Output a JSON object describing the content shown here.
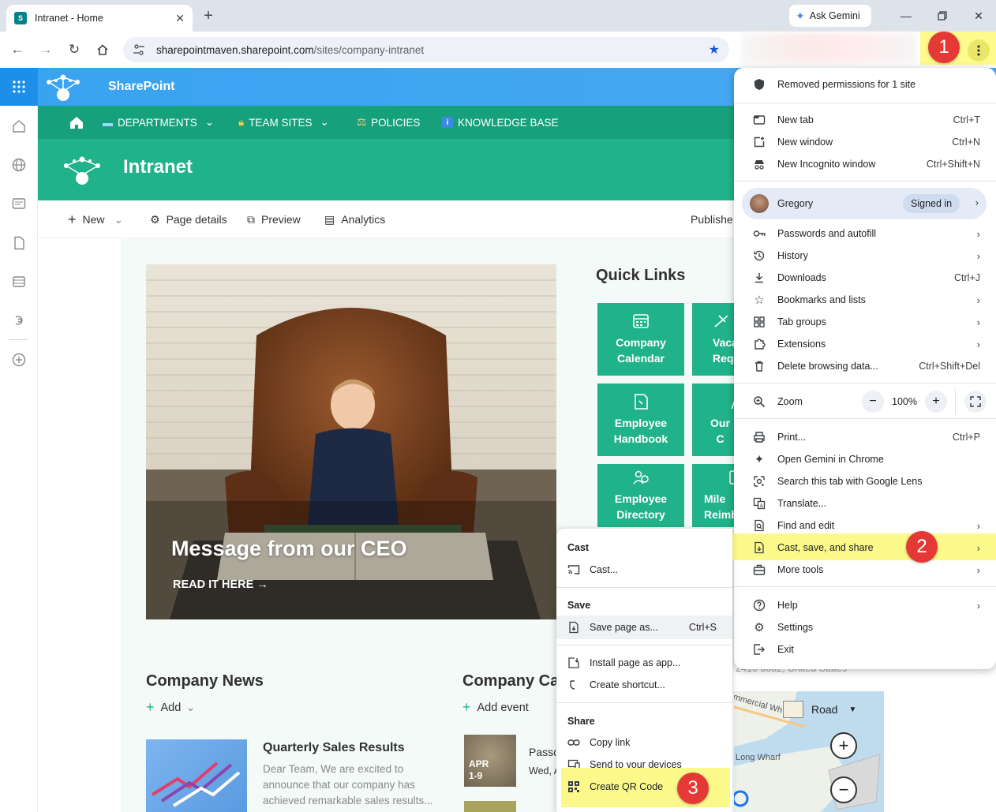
{
  "browser": {
    "tab_title": "Intranet - Home",
    "new_tab_symbol": "+",
    "ask_gemini": "Ask Gemini",
    "url_host": "sharepointmaven.sharepoint.com",
    "url_path": "/sites/company-intranet"
  },
  "sharepoint": {
    "suite_title": "SharePoint",
    "hub_nav": [
      {
        "label": "DEPARTMENTS",
        "icon": "laptop-icon",
        "dropdown": true
      },
      {
        "label": "TEAM SITES",
        "icon": "lock-icon",
        "dropdown": true
      },
      {
        "label": "POLICIES",
        "icon": "scales-icon",
        "dropdown": false
      },
      {
        "label": "KNOWLEDGE BASE",
        "icon": "info-icon",
        "dropdown": false
      }
    ],
    "site_title": "Intranet",
    "commands": {
      "new": "New",
      "page_details": "Page details",
      "preview": "Preview",
      "analytics": "Analytics",
      "published": "Publishe"
    },
    "hero": {
      "title": "Message from our CEO",
      "link": "READ IT HERE"
    },
    "quick_links": {
      "title": "Quick Links",
      "tiles": [
        {
          "line1": "Company",
          "line2": "Calendar"
        },
        {
          "line1": "Vaca",
          "line2": "Req"
        },
        {
          "line1": "Employee",
          "line2": "Handbook"
        },
        {
          "line1": "Our C",
          "line2": ""
        },
        {
          "line1": "Employee",
          "line2": "Directory"
        },
        {
          "line1": "Mile",
          "line2": "Reimb"
        }
      ]
    },
    "news": {
      "title": "Company News",
      "add": "Add",
      "item_title": "Quarterly Sales Results",
      "item_body": "Dear Team, We are excited to announce that our company has achieved remarkable sales results..."
    },
    "calendar": {
      "title": "Company Cal",
      "add": "Add event",
      "event_month": "APR",
      "event_days": "1-9",
      "event_title": "Passo",
      "event_date": "Wed, A"
    },
    "map": {
      "address": "2410 0002, United States",
      "style": "Road",
      "street1": "mmercial Wh",
      "street2": "Long Wharf"
    }
  },
  "chrome_menu": {
    "notice": "Removed permissions for 1 site",
    "items_top": [
      {
        "label": "New tab",
        "shortcut": "Ctrl+T",
        "icon": "new-tab-icon"
      },
      {
        "label": "New window",
        "shortcut": "Ctrl+N",
        "icon": "new-window-icon"
      },
      {
        "label": "New Incognito window",
        "shortcut": "Ctrl+Shift+N",
        "icon": "incognito-icon"
      }
    ],
    "profile": {
      "name": "Gregory",
      "status": "Signed in"
    },
    "items_mid": [
      {
        "label": "Passwords and autofill",
        "icon": "key-icon",
        "arrow": true
      },
      {
        "label": "History",
        "icon": "history-icon",
        "arrow": true
      },
      {
        "label": "Downloads",
        "shortcut": "Ctrl+J",
        "icon": "download-icon"
      },
      {
        "label": "Bookmarks and lists",
        "icon": "star-icon",
        "arrow": true
      },
      {
        "label": "Tab groups",
        "icon": "tab-groups-icon",
        "arrow": true
      },
      {
        "label": "Extensions",
        "icon": "puzzle-icon",
        "arrow": true
      },
      {
        "label": "Delete browsing data...",
        "shortcut": "Ctrl+Shift+Del",
        "icon": "trash-icon"
      }
    ],
    "zoom": {
      "label": "Zoom",
      "value": "100%",
      "minus": "−",
      "plus": "+"
    },
    "items_tools": [
      {
        "label": "Print...",
        "shortcut": "Ctrl+P",
        "icon": "print-icon"
      },
      {
        "label": "Open Gemini in Chrome",
        "icon": "gemini-icon"
      },
      {
        "label": "Search this tab with Google Lens",
        "icon": "lens-icon"
      },
      {
        "label": "Translate...",
        "icon": "translate-icon"
      },
      {
        "label": "Find and edit",
        "icon": "find-icon",
        "arrow": true
      },
      {
        "label": "Cast, save, and share",
        "icon": "cast-save-icon",
        "arrow": true
      },
      {
        "label": "More tools",
        "icon": "toolbox-icon",
        "arrow": true
      }
    ],
    "items_bottom": [
      {
        "label": "Help",
        "icon": "help-icon",
        "arrow": true
      },
      {
        "label": "Settings",
        "icon": "settings-icon"
      },
      {
        "label": "Exit",
        "icon": "exit-icon"
      }
    ]
  },
  "submenu": {
    "cast_header": "Cast",
    "cast_item": "Cast...",
    "save_header": "Save",
    "save_item": "Save page as...",
    "save_shortcut": "Ctrl+S",
    "install": "Install page as app...",
    "shortcut": "Create shortcut...",
    "share_header": "Share",
    "copy_link": "Copy link",
    "send": "Send to your devices",
    "qr": "Create QR Code"
  },
  "callouts": [
    "1",
    "2",
    "3"
  ],
  "colors": {
    "sharepoint_blue": "#38a3f1",
    "site_green": "#20b28a",
    "highlight_yellow": "#fbf989",
    "callout_red": "#e53935"
  }
}
